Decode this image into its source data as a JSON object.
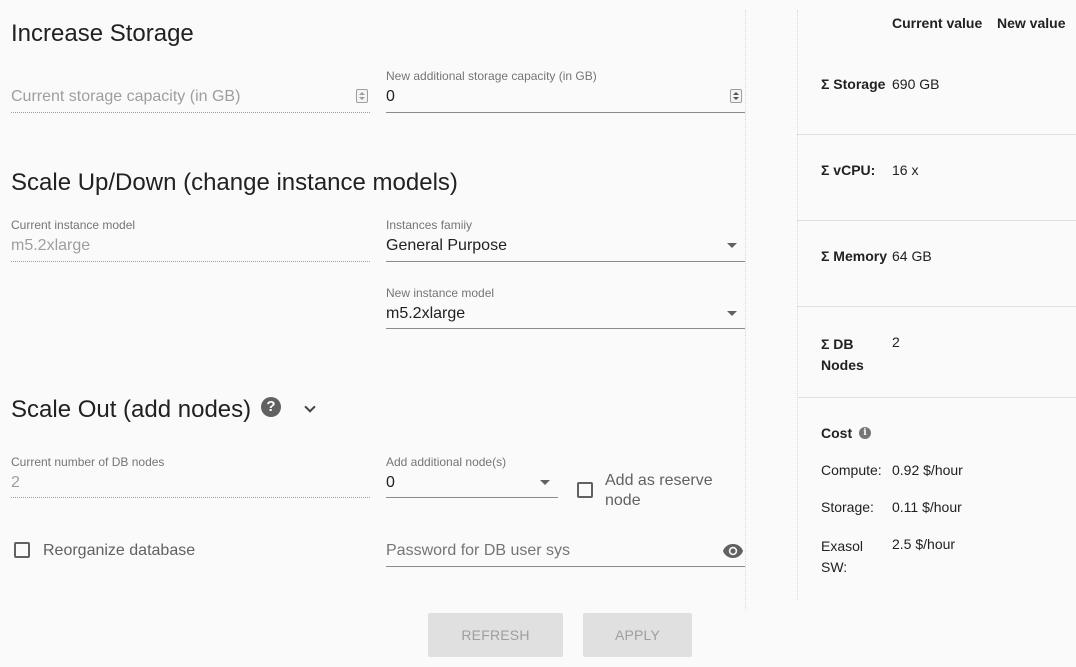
{
  "storage": {
    "title": "Increase Storage",
    "current_placeholder": "Current storage capacity (in GB)",
    "new_label": "New additional storage capacity (in GB)",
    "new_value": "0"
  },
  "scale_up": {
    "title": "Scale Up/Down (change instance models)",
    "current_label": "Current instance model",
    "current_value": "m5.2xlarge",
    "family_label": "Instances famiiy",
    "family_value": "General Purpose",
    "new_label": "New instance model",
    "new_value": "m5.2xlarge"
  },
  "scale_out": {
    "title": "Scale Out (add nodes)",
    "current_label": "Current number of DB nodes",
    "current_value": "2",
    "add_label": "Add additional node(s)",
    "add_value": "0",
    "reserve_label": "Add as reserve node",
    "reorganize_label": "Reorganize database",
    "password_placeholder": "Password for DB user sys"
  },
  "buttons": {
    "refresh": "REFRESH",
    "apply": "APPLY"
  },
  "summary": {
    "col_current": "Current value",
    "col_new": "New value",
    "rows": [
      {
        "label": "Σ Storage",
        "value": "690 GB"
      },
      {
        "label": "Σ vCPU:",
        "value": "16 x"
      },
      {
        "label": "Σ Memory",
        "value": "64 GB"
      },
      {
        "label": "Σ DB Nodes",
        "value": "2"
      }
    ],
    "cost": {
      "title": "Cost",
      "info_icon": "i",
      "items": [
        {
          "label": "Compute:",
          "value": "0.92 $/hour"
        },
        {
          "label": "Storage:",
          "value": "0.11 $/hour"
        },
        {
          "label": "Exasol SW:",
          "value": "2.5 $/hour"
        }
      ]
    }
  },
  "icons": {
    "help": "?"
  }
}
